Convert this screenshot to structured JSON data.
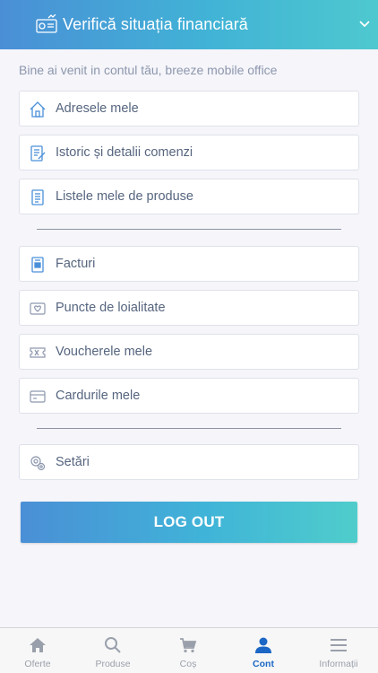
{
  "header": {
    "title": "Verifică situația financiară",
    "icon": "finance-report-icon",
    "chevron": "chevron-down-icon"
  },
  "welcome_text": "Bine ai venit in contul tău, breeze mobile office",
  "menu_group_1": [
    {
      "label": "Adresele mele",
      "icon": "home-icon"
    },
    {
      "label": "Istoric și detalii comenzi",
      "icon": "order-history-icon"
    },
    {
      "label": "Listele mele de produse",
      "icon": "list-icon"
    }
  ],
  "menu_group_2": [
    {
      "label": "Facturi",
      "icon": "invoice-icon"
    },
    {
      "label": "Puncte de loialitate",
      "icon": "loyalty-icon"
    },
    {
      "label": "Voucherele mele",
      "icon": "voucher-icon"
    },
    {
      "label": "Cardurile mele",
      "icon": "card-icon"
    }
  ],
  "menu_group_3": [
    {
      "label": "Setări",
      "icon": "settings-icon"
    }
  ],
  "logout_label": "LOG OUT",
  "tabs": [
    {
      "label": "Oferte",
      "icon": "home-icon",
      "active": false
    },
    {
      "label": "Produse",
      "icon": "search-icon",
      "active": false
    },
    {
      "label": "Coș",
      "icon": "cart-icon",
      "active": false
    },
    {
      "label": "Cont",
      "icon": "user-icon",
      "active": true
    },
    {
      "label": "Informații",
      "icon": "menu-icon",
      "active": false
    }
  ],
  "colors": {
    "accent_start": "#4a8fd6",
    "accent_end": "#4ec8cf",
    "active_tab": "#1c67c5",
    "icon_blue": "#4a90d9"
  }
}
